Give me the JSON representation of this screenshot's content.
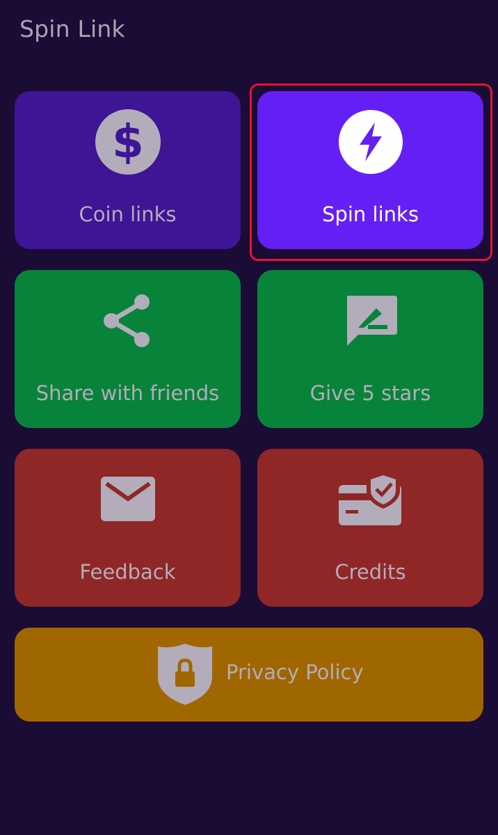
{
  "app": {
    "title": "Spin Link"
  },
  "colors": {
    "background": "#1b0c36",
    "title_text": "#a9a4b4",
    "muted_text": "#b3adbb",
    "active_text": "#ffffff",
    "purple_dim": "#3e1594",
    "purple_active": "#6420f4",
    "green": "#08833a",
    "red": "#8f2726",
    "amber": "#a06600",
    "icon_dim": "#b3adbb",
    "icon_active": "#ffffff",
    "selection_outline": "#e8152c"
  },
  "tiles": {
    "coin_links": {
      "label": "Coin links",
      "icon": "dollar-circle-icon"
    },
    "spin_links": {
      "label": "Spin links",
      "icon": "lightning-bolt-icon",
      "selected": true
    },
    "share": {
      "label": "Share with friends",
      "icon": "share-icon"
    },
    "rate": {
      "label": "Give 5 stars",
      "icon": "rate-review-icon"
    },
    "feedback": {
      "label": "Feedback",
      "icon": "mail-icon"
    },
    "credits": {
      "label": "Credits",
      "icon": "secure-card-icon"
    },
    "privacy": {
      "label": "Privacy Policy",
      "icon": "shield-lock-icon"
    }
  }
}
